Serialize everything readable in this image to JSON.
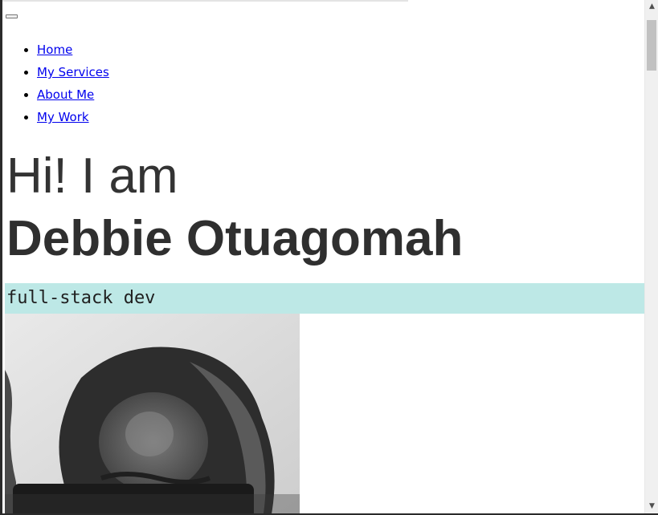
{
  "nav": {
    "items": [
      {
        "label": "Home"
      },
      {
        "label": "My Services"
      },
      {
        "label": "About Me"
      },
      {
        "label": "My Work"
      }
    ]
  },
  "hero": {
    "intro": "Hi! I am",
    "name": "Debbie Otuagomah",
    "role": "full-stack dev"
  },
  "colors": {
    "role_bar_bg": "#bde8e6",
    "heading": "#2f2f2f",
    "link": "#0000ee"
  },
  "scrollbar": {
    "up_icon": "scroll-up-arrow-icon",
    "down_icon": "scroll-down-arrow-icon"
  }
}
